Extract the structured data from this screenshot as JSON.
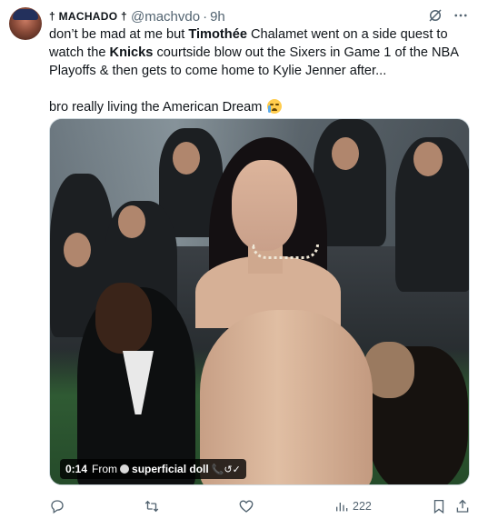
{
  "tweet": {
    "author": {
      "display_name": "† MACHADO †",
      "handle": "@machvdo",
      "separator": "·",
      "time": "9h"
    },
    "text": {
      "p1_part1": "don’t be mad at me but ",
      "p1_bold1": "Timothée",
      "p1_part2": " Chalamet went on a side quest to watch the ",
      "p1_bold2": "Knicks",
      "p1_part3": " courtside blow out the Sixers in Game 1 of the NBA Playoffs & then gets to come home to Kylie Jenner after...",
      "p2": "bro really living the American Dream"
    },
    "emoji_name": "loudly-crying-face",
    "video": {
      "timestamp": "0:14",
      "from_label": "From",
      "source_name": "superficial doll",
      "source_decoration": "📞↺✓"
    },
    "actions": {
      "reply_icon": "reply-icon",
      "retweet_icon": "retweet-icon",
      "like_icon": "heart-icon",
      "views_icon": "views-icon",
      "views_count": "222",
      "bookmark_icon": "bookmark-icon",
      "share_icon": "share-icon"
    },
    "header_icons": [
      "grok-icon",
      "more-icon"
    ],
    "colors": {
      "text": "#0f1419",
      "secondary": "#536471",
      "border": "#cfd9de"
    }
  }
}
